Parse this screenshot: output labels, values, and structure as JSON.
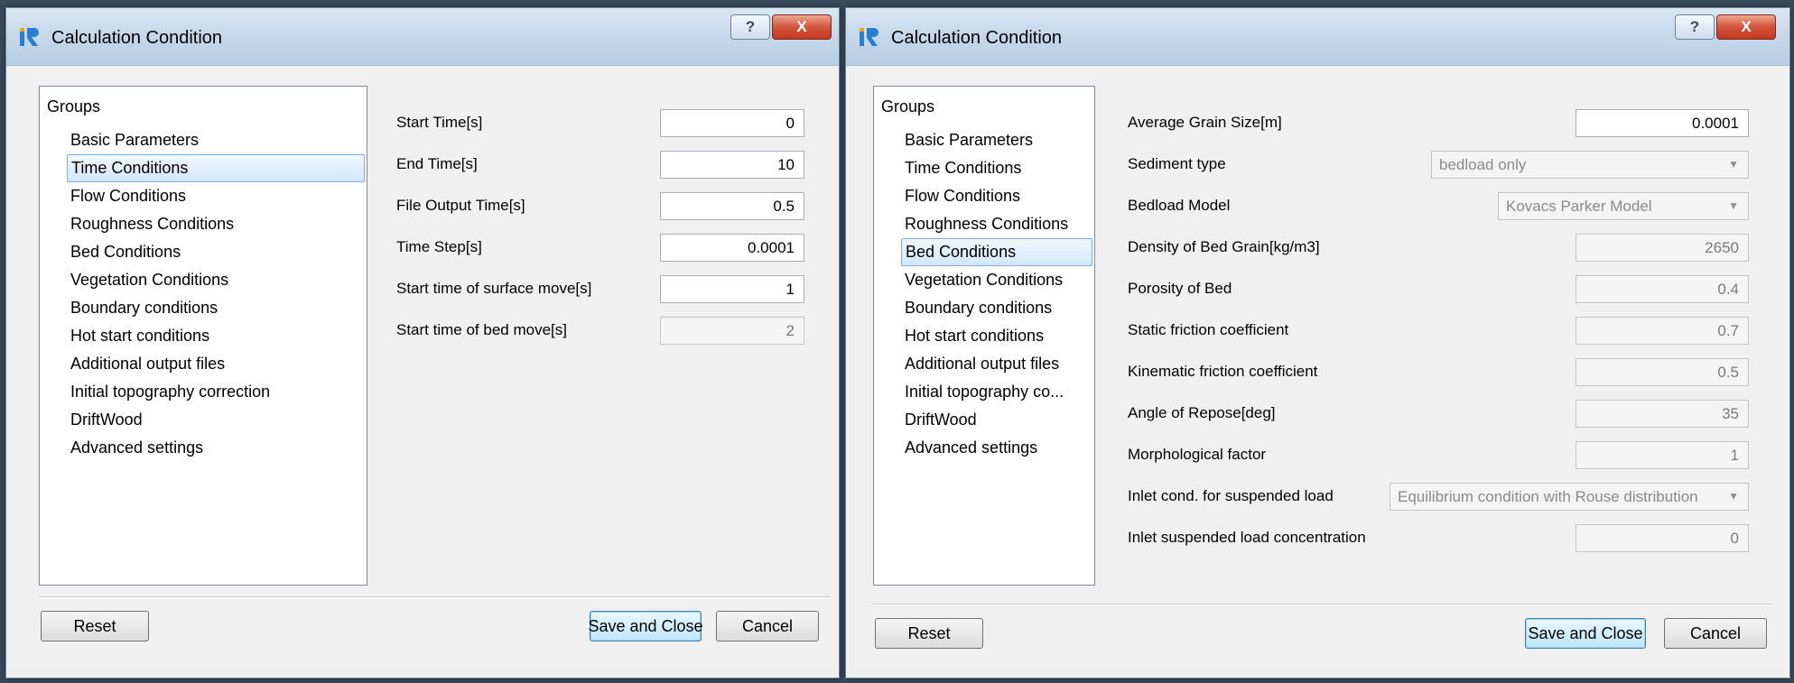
{
  "dialog_left": {
    "title": "Calculation Condition",
    "help_label": "?",
    "close_label": "X",
    "groups_header": "Groups",
    "groups": [
      "Basic Parameters",
      "Time Conditions",
      "Flow Conditions",
      "Roughness Conditions",
      "Bed Conditions",
      "Vegetation Conditions",
      "Boundary conditions",
      "Hot start conditions",
      "Additional output files",
      "Initial topography correction",
      "DriftWood",
      "Advanced settings"
    ],
    "selected_group": "Time Conditions",
    "fields": [
      {
        "label": "Start Time[s]",
        "value": "0",
        "enabled": true
      },
      {
        "label": "End Time[s]",
        "value": "10",
        "enabled": true
      },
      {
        "label": "File Output Time[s]",
        "value": "0.5",
        "enabled": true
      },
      {
        "label": "Time Step[s]",
        "value": "0.0001",
        "enabled": true
      },
      {
        "label": "Start time of surface move[s]",
        "value": "1",
        "enabled": true
      },
      {
        "label": "Start time of bed move[s]",
        "value": "2",
        "enabled": false
      }
    ],
    "buttons": {
      "reset": "Reset",
      "save_close": "Save and Close",
      "cancel": "Cancel"
    }
  },
  "dialog_right": {
    "title": "Calculation Condition",
    "help_label": "?",
    "close_label": "X",
    "groups_header": "Groups",
    "groups": [
      "Basic Parameters",
      "Time Conditions",
      "Flow Conditions",
      "Roughness Conditions",
      "Bed Conditions",
      "Vegetation Conditions",
      "Boundary conditions",
      "Hot start conditions",
      "Additional output files",
      "Initial topography co...",
      "DriftWood",
      "Advanced settings"
    ],
    "selected_group": "Bed Conditions",
    "fields": [
      {
        "label": "Average Grain Size[m]",
        "value": "0.0001",
        "kind": "text",
        "enabled": true
      },
      {
        "label": "Sediment type",
        "value": "bedload only",
        "kind": "combo",
        "enabled": false
      },
      {
        "label": "Bedload Model",
        "value": "Kovacs Parker Model",
        "kind": "combo",
        "enabled": false
      },
      {
        "label": "Density of Bed Grain[kg/m3]",
        "value": "2650",
        "kind": "text",
        "enabled": false
      },
      {
        "label": "Porosity of Bed",
        "value": "0.4",
        "kind": "text",
        "enabled": false
      },
      {
        "label": "Static friction coefficient",
        "value": "0.7",
        "kind": "text",
        "enabled": false
      },
      {
        "label": "Kinematic friction coefficient",
        "value": "0.5",
        "kind": "text",
        "enabled": false
      },
      {
        "label": "Angle of Repose[deg]",
        "value": "35",
        "kind": "text",
        "enabled": false
      },
      {
        "label": "Morphological factor",
        "value": "1",
        "kind": "text",
        "enabled": false
      },
      {
        "label": "Inlet cond. for suspended load",
        "value": "Equilibrium condition with Rouse distribution",
        "kind": "combo",
        "enabled": false
      },
      {
        "label": "Inlet suspended load concentration",
        "value": "0",
        "kind": "text",
        "enabled": false
      }
    ],
    "buttons": {
      "reset": "Reset",
      "save_close": "Save and Close",
      "cancel": "Cancel"
    }
  },
  "colors": {
    "title_gradient_top": "#dbe7f3",
    "title_gradient_bottom": "#b7cde3",
    "close_button": "#c23a22",
    "selection_border": "#84acdd",
    "default_button_border": "#3c7fb1",
    "dialog_background": "#f0f0f0"
  },
  "icons": {
    "app": "iric-app-icon",
    "help": "help-icon",
    "close": "close-icon",
    "combo_arrow": "chevron-down-icon"
  }
}
